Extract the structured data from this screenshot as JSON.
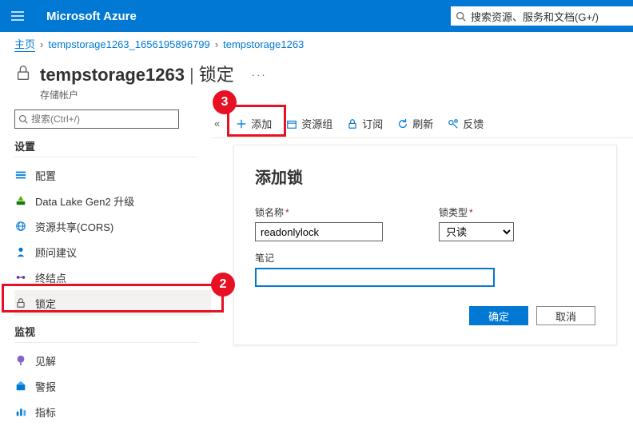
{
  "header": {
    "brand": "Microsoft Azure",
    "global_search_placeholder": "搜索资源、服务和文档(G+/)"
  },
  "breadcrumb": {
    "home": "主页",
    "items": [
      "tempstorage1263_1656195896799",
      "tempstorage1263"
    ]
  },
  "title": {
    "resource": "tempstorage1263",
    "section": "锁定",
    "subtitle": "存储帐户"
  },
  "left": {
    "search_placeholder": "搜索(Ctrl+/)",
    "groups": [
      {
        "label": "设置",
        "items": [
          {
            "label": "配置",
            "icon": "config",
            "color": "#0078d4"
          },
          {
            "label": "Data Lake Gen2 升级",
            "icon": "datalake",
            "color": "#107c10"
          },
          {
            "label": "资源共享(CORS)",
            "icon": "cors",
            "color": "#0078d4"
          },
          {
            "label": "顾问建议",
            "icon": "advisor",
            "color": "#0078d4"
          },
          {
            "label": "终结点",
            "icon": "endpoint",
            "color": "#5c2d91"
          },
          {
            "label": "锁定",
            "icon": "lock",
            "color": "#605e5c",
            "selected": true
          }
        ]
      },
      {
        "label": "监视",
        "items": [
          {
            "label": "见解",
            "icon": "insights",
            "color": "#8661c5"
          },
          {
            "label": "警报",
            "icon": "alerts",
            "color": "#0078d4"
          },
          {
            "label": "指标",
            "icon": "metrics",
            "color": "#0078d4"
          }
        ]
      }
    ]
  },
  "toolbar": {
    "add": "添加",
    "resource_group": "资源组",
    "subscription": "订阅",
    "refresh": "刷新",
    "feedback": "反馈"
  },
  "panel": {
    "title": "添加锁",
    "name_label": "锁名称",
    "name_value": "readonlylock",
    "type_label": "锁类型",
    "type_value": "只读",
    "notes_label": "笔记",
    "notes_value": "",
    "ok": "确定",
    "cancel": "取消"
  },
  "callouts": {
    "two": "2",
    "three": "3"
  }
}
